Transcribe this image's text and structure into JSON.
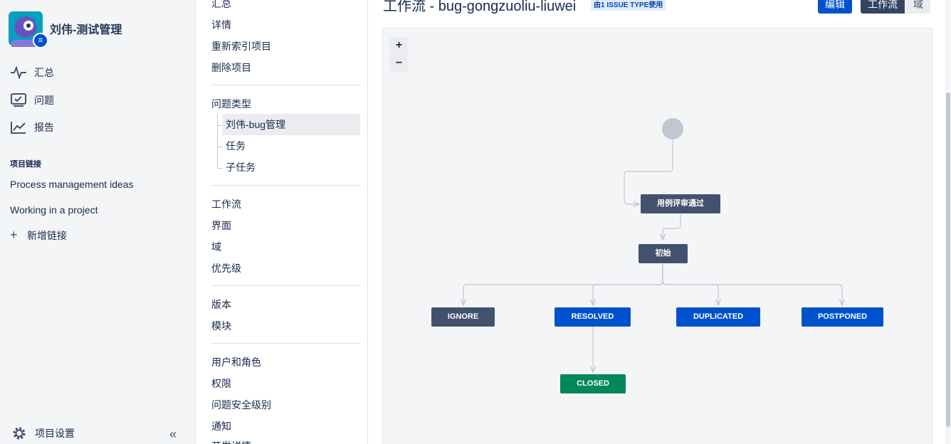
{
  "sidebar": {
    "project_name": "刘伟-测试管理",
    "nav": [
      {
        "label": "汇总",
        "icon": "pulse-icon"
      },
      {
        "label": "问题",
        "icon": "issues-icon"
      },
      {
        "label": "报告",
        "icon": "chart-icon"
      }
    ],
    "links_title": "项目链接",
    "links": [
      "Process management ideas",
      "Working in a project"
    ],
    "add_link": "新增链接",
    "settings": "项目设置",
    "collapse": "«"
  },
  "subnav": {
    "top_items": [
      "汇总",
      "详情",
      "重新索引项目",
      "删除项目"
    ],
    "issue_types_title": "问题类型",
    "issue_types": [
      "刘伟-bug管理",
      "任务",
      "子任务"
    ],
    "group2": [
      "工作流",
      "界面",
      "域",
      "优先级"
    ],
    "group3": [
      "版本",
      "模块"
    ],
    "group4": [
      "用户和角色",
      "权限",
      "问题安全级别",
      "通知",
      "开发详情"
    ]
  },
  "main": {
    "title": "工作流 - bug-gongzuoliu-liuwei",
    "usage_badge": "由1 ISSUE TYPE使用",
    "edit_button": "编辑",
    "view_workflow": "工作流",
    "view_domain": "域",
    "zoom_in": "+",
    "zoom_out": "−"
  },
  "workflow": {
    "nodes": {
      "review": "用例评审通过",
      "initial": "初始",
      "ignore": "IGNORE",
      "resolved": "RESOLVED",
      "duplicated": "DUPLICATED",
      "postponed": "POSTPONED",
      "closed": "CLOSED"
    },
    "colors": {
      "gray": "#42526e",
      "blue": "#0052cc",
      "green": "#00875a"
    }
  }
}
